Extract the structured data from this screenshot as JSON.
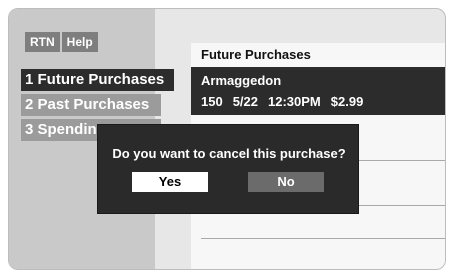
{
  "top_buttons": {
    "rtn": "RTN",
    "help": "Help"
  },
  "menu": {
    "items": [
      {
        "label": "1 Future Purchases"
      },
      {
        "label": "2 Past Purchases"
      },
      {
        "label": "3 Spending"
      }
    ]
  },
  "content": {
    "title": "Future Purchases",
    "selected": {
      "title": "Armaggedon",
      "channel": "150",
      "date": "5/22",
      "time": "12:30PM",
      "price": "$2.99"
    }
  },
  "dialog": {
    "message": "Do you want to cancel this purchase?",
    "yes": "Yes",
    "no": "No"
  }
}
